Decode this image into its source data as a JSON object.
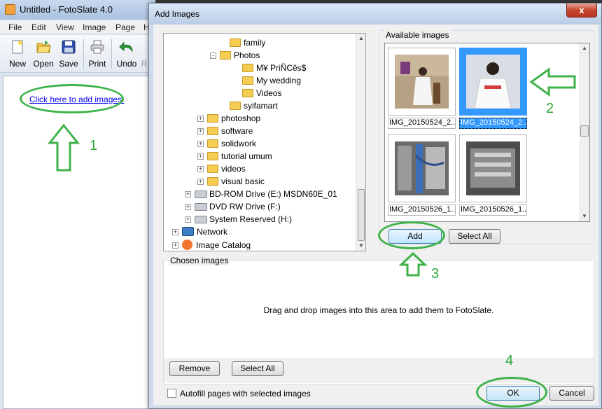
{
  "main": {
    "title": "Untitled - FotoSlate 4.0",
    "menu": [
      "File",
      "Edit",
      "View",
      "Image",
      "Page",
      "H"
    ],
    "toolbar": {
      "new": "New",
      "open": "Open",
      "save": "Save",
      "print": "Print",
      "undo": "Undo",
      "partial": "R"
    },
    "add_images_link": "Click here to add images."
  },
  "dialog": {
    "title": "Add Images",
    "close_glyph": "x",
    "tree": [
      {
        "label": "family",
        "type": "folder"
      },
      {
        "label": "Photos",
        "type": "folder",
        "expander": "-"
      },
      {
        "label": "M¥ PriÑCês$",
        "type": "folder"
      },
      {
        "label": "My wedding",
        "type": "folder"
      },
      {
        "label": "Videos",
        "type": "folder"
      },
      {
        "label": "syifamart",
        "type": "folder"
      },
      {
        "label": "photoshop",
        "type": "folder",
        "expander": "+"
      },
      {
        "label": "software",
        "type": "folder",
        "expander": "+"
      },
      {
        "label": "solidwork",
        "type": "folder",
        "expander": "+"
      },
      {
        "label": "tutorial umum",
        "type": "folder",
        "expander": "+"
      },
      {
        "label": "videos",
        "type": "folder",
        "expander": "+"
      },
      {
        "label": "visual basic",
        "type": "folder",
        "expander": "+"
      },
      {
        "label": "BD-ROM Drive (E:) MSDN60E_01",
        "type": "drive",
        "expander": "+"
      },
      {
        "label": "DVD RW Drive (F:)",
        "type": "drive",
        "expander": "+"
      },
      {
        "label": "System Reserved (H:)",
        "type": "drive",
        "expander": "+"
      },
      {
        "label": "Network",
        "type": "network",
        "expander": "+"
      },
      {
        "label": "Image Catalog",
        "type": "catalog",
        "expander": "+"
      }
    ],
    "available_label": "Available images",
    "images": [
      {
        "caption": "IMG_20150524_2...",
        "selected": false
      },
      {
        "caption": "IMG_20150524_2...",
        "selected": true
      },
      {
        "caption": "IMG_20150526_1...",
        "selected": false
      },
      {
        "caption": "IMG_20150526_1...",
        "selected": false
      }
    ],
    "add_button": "Add",
    "select_all_button": "Select All",
    "chosen_label": "Chosen images",
    "chosen_hint": "Drag and drop images into this area to add them to FotoSlate.",
    "remove_button": "Remove",
    "chosen_select_all_button": "Select All",
    "autofill_label": "Autofill pages with selected images",
    "autofill_checked": false,
    "ok_button": "OK",
    "cancel_button": "Cancel"
  },
  "annotations": [
    "1",
    "2",
    "3",
    "4"
  ],
  "colors": {
    "annotation_green": "#3fb34a",
    "selection_blue": "#3399ff",
    "link_blue": "#0000ee"
  }
}
